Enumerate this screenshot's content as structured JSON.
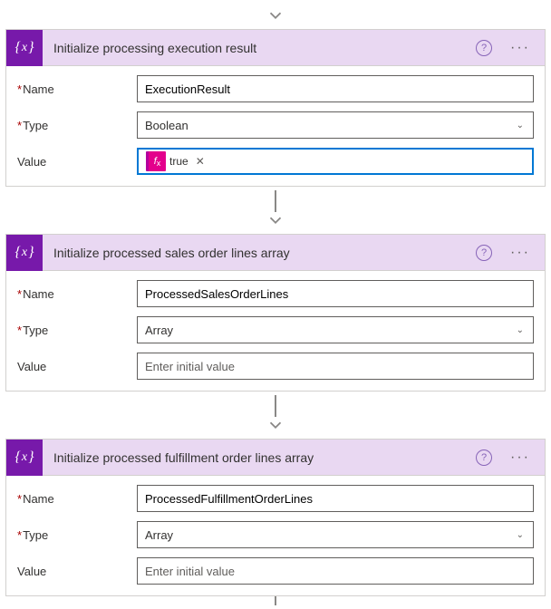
{
  "labels": {
    "name": "Name",
    "type": "Type",
    "value": "Value",
    "valuePlaceholder": "Enter initial value"
  },
  "icons": {
    "help": "?",
    "more": "···"
  },
  "cards": [
    {
      "title": "Initialize processing execution result",
      "name": "ExecutionResult",
      "type": "Boolean",
      "valueMode": "expression",
      "valueExpression": "true",
      "valueFocused": true
    },
    {
      "title": "Initialize processed sales order lines array",
      "name": "ProcessedSalesOrderLines",
      "type": "Array",
      "valueMode": "empty"
    },
    {
      "title": "Initialize processed fulfillment order lines array",
      "name": "ProcessedFulfillmentOrderLines",
      "type": "Array",
      "valueMode": "empty"
    }
  ]
}
